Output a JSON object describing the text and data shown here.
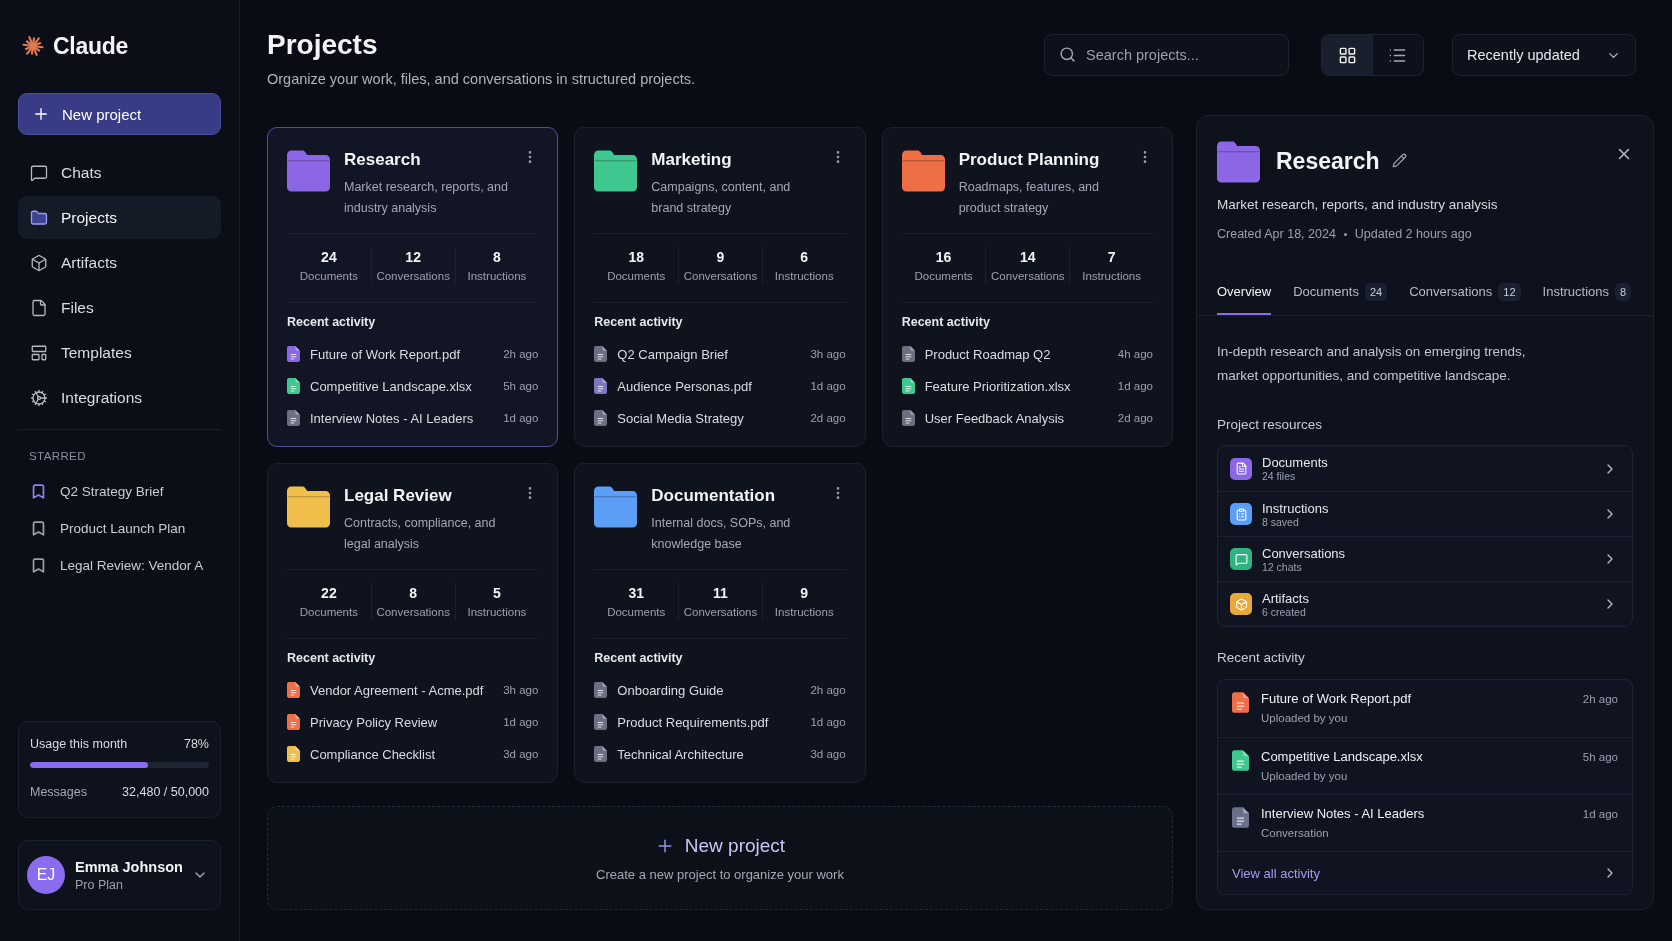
{
  "sidebar": {
    "logo": "Claude",
    "new_project": "New project",
    "nav": [
      {
        "label": "Chats",
        "selected": false
      },
      {
        "label": "Projects",
        "selected": true
      },
      {
        "label": "Artifacts",
        "selected": false
      },
      {
        "label": "Files",
        "selected": false
      },
      {
        "label": "Templates",
        "selected": false
      },
      {
        "label": "Integrations",
        "selected": false
      }
    ],
    "starred_heading": "STARRED",
    "starred": [
      {
        "label": "Q2 Strategy Brief",
        "color": "#8a86e6"
      },
      {
        "label": "Product Launch Plan",
        "color": "#9aa0ad"
      },
      {
        "label": "Legal Review: Vendor A",
        "color": "#9aa0ad"
      }
    ],
    "usage": {
      "title": "Usage this month",
      "percent": "78%",
      "level": 0.66,
      "messages_label": "Messages",
      "messages_value": "32,480 / 50,000"
    },
    "user": {
      "initials": "EJ",
      "name": "Emma Johnson",
      "plan": "Pro Plan"
    }
  },
  "header": {
    "title": "Projects",
    "subtitle": "Organize your work, files, and conversations in structured projects.",
    "search": {
      "placeholder": "Search projects..."
    },
    "views": [
      {
        "kind": "grid",
        "selected": true
      },
      {
        "kind": "list",
        "selected": false
      }
    ],
    "sort": {
      "value": "Recently updated"
    }
  },
  "projects": [
    {
      "name": "Research",
      "description": "Market research, reports, and industry analysis",
      "color": "#8b67e6",
      "selected": true,
      "stats": [
        {
          "value": "24",
          "label": "Documents"
        },
        {
          "value": "12",
          "label": "Conversations"
        },
        {
          "value": "8",
          "label": "Instructions"
        }
      ],
      "activity_heading": "Recent activity",
      "activity": [
        {
          "name": "Future of Work Report.pdf",
          "time": "2h ago",
          "color": "#8b67e6"
        },
        {
          "name": "Competitive Landscape.xlsx",
          "time": "5h ago",
          "color": "#3ec78f"
        },
        {
          "name": "Interview Notes - AI Leaders",
          "time": "1d ago",
          "color": "#6b7080"
        }
      ]
    },
    {
      "name": "Marketing",
      "description": "Campaigns, content, and brand strategy",
      "color": "#3ec78f",
      "selected": false,
      "stats": [
        {
          "value": "18",
          "label": "Documents"
        },
        {
          "value": "9",
          "label": "Conversations"
        },
        {
          "value": "6",
          "label": "Instructions"
        }
      ],
      "activity_heading": "Recent activity",
      "activity": [
        {
          "name": "Q2 Campaign Brief",
          "time": "3h ago",
          "color": "#6b7080"
        },
        {
          "name": "Audience Personas.pdf",
          "time": "1d ago",
          "color": "#7e76c0"
        },
        {
          "name": "Social Media Strategy",
          "time": "2d ago",
          "color": "#6b7080"
        }
      ]
    },
    {
      "name": "Product Planning",
      "description": "Roadmaps, features, and product strategy",
      "color": "#ee6e45",
      "selected": false,
      "stats": [
        {
          "value": "16",
          "label": "Documents"
        },
        {
          "value": "14",
          "label": "Conversations"
        },
        {
          "value": "7",
          "label": "Instructions"
        }
      ],
      "activity_heading": "Recent activity",
      "activity": [
        {
          "name": "Product Roadmap Q2",
          "time": "4h ago",
          "color": "#6b7080"
        },
        {
          "name": "Feature Prioritization.xlsx",
          "time": "1d ago",
          "color": "#3ec78f"
        },
        {
          "name": "User Feedback Analysis",
          "time": "2d ago",
          "color": "#6b7080"
        }
      ]
    },
    {
      "name": "Legal Review",
      "description": "Contracts, compliance, and legal analysis",
      "color": "#efbf4a",
      "selected": false,
      "stats": [
        {
          "value": "22",
          "label": "Documents"
        },
        {
          "value": "8",
          "label": "Conversations"
        },
        {
          "value": "5",
          "label": "Instructions"
        }
      ],
      "activity_heading": "Recent activity",
      "activity": [
        {
          "name": "Vendor Agreement - Acme.pdf",
          "time": "3h ago",
          "color": "#ee6e45"
        },
        {
          "name": "Privacy Policy Review",
          "time": "1d ago",
          "color": "#ee6e45"
        },
        {
          "name": "Compliance Checklist",
          "time": "3d ago",
          "color": "#efbf4a"
        }
      ]
    },
    {
      "name": "Documentation",
      "description": "Internal docs, SOPs, and knowledge base",
      "color": "#5a9ef5",
      "selected": false,
      "stats": [
        {
          "value": "31",
          "label": "Documents"
        },
        {
          "value": "11",
          "label": "Conversations"
        },
        {
          "value": "9",
          "label": "Instructions"
        }
      ],
      "activity_heading": "Recent activity",
      "activity": [
        {
          "name": "Onboarding Guide",
          "time": "2h ago",
          "color": "#6b7080"
        },
        {
          "name": "Product Requirements.pdf",
          "time": "1d ago",
          "color": "#6b7080"
        },
        {
          "name": "Technical Architecture",
          "time": "3d ago",
          "color": "#6b7080"
        }
      ]
    }
  ],
  "new_project_card": {
    "title": "New project",
    "hint": "Create a new project to organize your work"
  },
  "detail": {
    "title": "Research",
    "color": "#8b67e6",
    "description": "Market research, reports, and industry analysis",
    "created": "Created Apr 18, 2024",
    "updated": "Updated 2 hours ago",
    "tabs": [
      {
        "label": "Overview",
        "selected": true
      },
      {
        "label": "Documents",
        "count": "24",
        "selected": false
      },
      {
        "label": "Conversations",
        "count": "12",
        "selected": false
      },
      {
        "label": "Instructions",
        "count": "8",
        "selected": false
      }
    ],
    "overview": "In-depth research and analysis on emerging trends, market opportunities, and competitive landscape.",
    "resources_heading": "Project resources",
    "resources": [
      {
        "title": "Documents",
        "subtitle": "24 files",
        "color": "#8b67e6"
      },
      {
        "title": "Instructions",
        "subtitle": "8 saved",
        "color": "#5a9ef5"
      },
      {
        "title": "Conversations",
        "subtitle": "12 chats",
        "color": "#2fb383"
      },
      {
        "title": "Artifacts",
        "subtitle": "6 created",
        "color": "#e9a93a"
      }
    ],
    "activity_heading": "Recent activity",
    "activity": [
      {
        "name": "Future of Work Report.pdf",
        "subtitle": "Uploaded by you",
        "time": "2h ago",
        "color": "#ee6e45"
      },
      {
        "name": "Competitive Landscape.xlsx",
        "subtitle": "Uploaded by you",
        "time": "5h ago",
        "color": "#3ec78f"
      },
      {
        "name": "Interview Notes - AI Leaders",
        "subtitle": "Conversation",
        "time": "1d ago",
        "color": "#6c6f8c"
      }
    ],
    "view_all": "View all activity"
  }
}
